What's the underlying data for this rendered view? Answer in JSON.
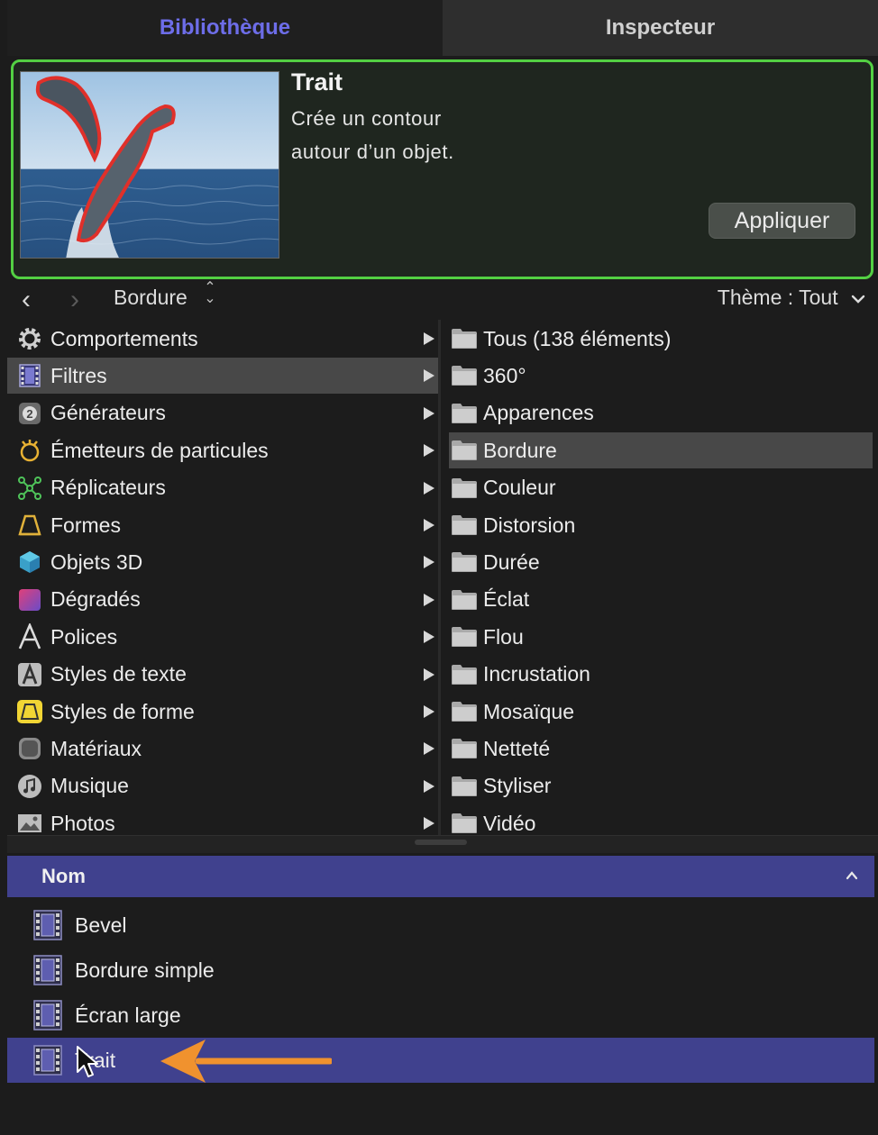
{
  "tabs": [
    {
      "label": "Bibliothèque",
      "active": true
    },
    {
      "label": "Inspecteur",
      "active": false
    }
  ],
  "preview": {
    "title": "Trait",
    "description_line1": "Crée un contour",
    "description_line2": "autour d’un objet.",
    "apply_label": "Appliquer"
  },
  "navbar": {
    "breadcrumb": "Bordure",
    "theme_label": "Thème : Tout"
  },
  "categories": [
    {
      "label": "Comportements",
      "icon": "gear-icon"
    },
    {
      "label": "Filtres",
      "icon": "film-icon",
      "selected": true
    },
    {
      "label": "Générateurs",
      "icon": "generator-icon"
    },
    {
      "label": "Émetteurs de particules",
      "icon": "emitter-icon"
    },
    {
      "label": "Réplicateurs",
      "icon": "replicator-icon"
    },
    {
      "label": "Formes",
      "icon": "shape-icon"
    },
    {
      "label": "Objets 3D",
      "icon": "cube-icon"
    },
    {
      "label": "Dégradés",
      "icon": "gradient-icon"
    },
    {
      "label": "Polices",
      "icon": "font-icon"
    },
    {
      "label": "Styles de texte",
      "icon": "text-style-icon"
    },
    {
      "label": "Styles de forme",
      "icon": "shape-style-icon"
    },
    {
      "label": "Matériaux",
      "icon": "material-icon"
    },
    {
      "label": "Musique",
      "icon": "music-icon"
    },
    {
      "label": "Photos",
      "icon": "photo-icon"
    }
  ],
  "folders": [
    {
      "label": "Tous (138 éléments)"
    },
    {
      "label": "360°"
    },
    {
      "label": "Apparences"
    },
    {
      "label": "Bordure",
      "selected": true
    },
    {
      "label": "Couleur"
    },
    {
      "label": "Distorsion"
    },
    {
      "label": "Durée"
    },
    {
      "label": "Éclat"
    },
    {
      "label": "Flou"
    },
    {
      "label": "Incrustation"
    },
    {
      "label": "Mosaïque"
    },
    {
      "label": "Netteté"
    },
    {
      "label": "Styliser"
    },
    {
      "label": "Vidéo"
    }
  ],
  "list": {
    "header": "Nom",
    "items": [
      {
        "label": "Bevel"
      },
      {
        "label": "Bordure simple"
      },
      {
        "label": "Écran large"
      },
      {
        "label": "Trait",
        "selected": true
      }
    ]
  },
  "colors": {
    "accent": "#40418e",
    "active_tab_text": "#6d6de8",
    "preview_border": "#53d043",
    "annotation_arrow": "#f0922e"
  }
}
